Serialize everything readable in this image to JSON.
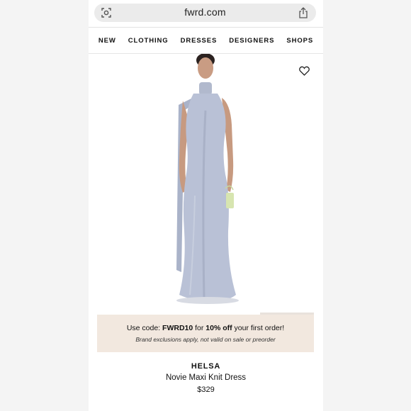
{
  "browser": {
    "url": "fwrd.com",
    "page_icon": "page-settings-icon",
    "share_icon": "share-icon"
  },
  "nav": {
    "items": [
      "NEW",
      "CLOTHING",
      "DRESSES",
      "DESIGNERS",
      "SHOPS"
    ]
  },
  "hero": {
    "wishlist_icon": "heart-icon"
  },
  "promo": {
    "prefix": "Use code: ",
    "code": "FWRD10",
    "middle": " for ",
    "discount": "10% off",
    "suffix": " your first order!",
    "note": "Brand exclusions apply, not valid on sale or preorder"
  },
  "product": {
    "brand": "HELSA",
    "name": "Novie Maxi Knit Dress",
    "price": "$329"
  },
  "colors": {
    "dress": "#b9c1d6",
    "promo_bg": "#f2e8df",
    "url_bar": "#ebebeb"
  }
}
